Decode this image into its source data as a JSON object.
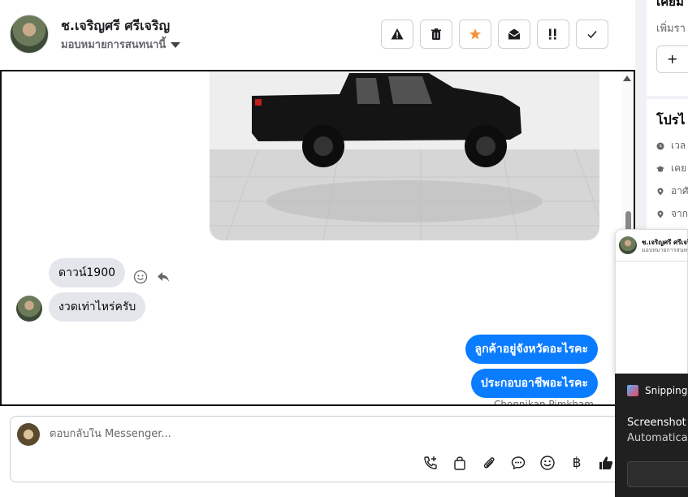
{
  "header": {
    "contact_name": "ช.เจริญศรี ศรีเจริญ",
    "assign_label": "มอบหมายการสนทนานี้",
    "actions": [
      {
        "name": "spam-button",
        "icon": "warning-icon"
      },
      {
        "name": "delete-button",
        "icon": "trash-icon"
      },
      {
        "name": "star-button",
        "icon": "star-icon"
      },
      {
        "name": "mark-unread-button",
        "icon": "open-envelope-icon"
      },
      {
        "name": "follow-up-button",
        "icon": "priority-icon"
      },
      {
        "name": "done-button",
        "icon": "check-icon"
      }
    ],
    "star_color": "#f7923b"
  },
  "thread": {
    "messages": [
      {
        "direction": "in",
        "text": "ดาวน์1900"
      },
      {
        "direction": "in",
        "text": "งวดเท่าไหร่ครับ"
      },
      {
        "direction": "out",
        "text": "ลูกค้าอยู่จังหวัดอะไรคะ"
      },
      {
        "direction": "out",
        "text": "ประกอบอาชีพอะไรคะ"
      }
    ],
    "sender_name": "Chonnikan Pimkham",
    "accent_color": "#0a7cff"
  },
  "composer": {
    "placeholder": "ตอบกลับใน Messenger..."
  },
  "right_panel": {
    "heading": "เคยม",
    "subtext": "เพิ่มรา",
    "add_label": "+",
    "section_title": "โปรไ",
    "rows": [
      "เวล",
      "เคย",
      "อาศั",
      "จาก"
    ]
  },
  "popup": {
    "name": "ช.เจริญศรี ศรีเจริ",
    "sub": "มอบหมายการสนท"
  },
  "toast": {
    "app": "Snipping",
    "title": "Screenshot c",
    "body": "Automatical"
  }
}
